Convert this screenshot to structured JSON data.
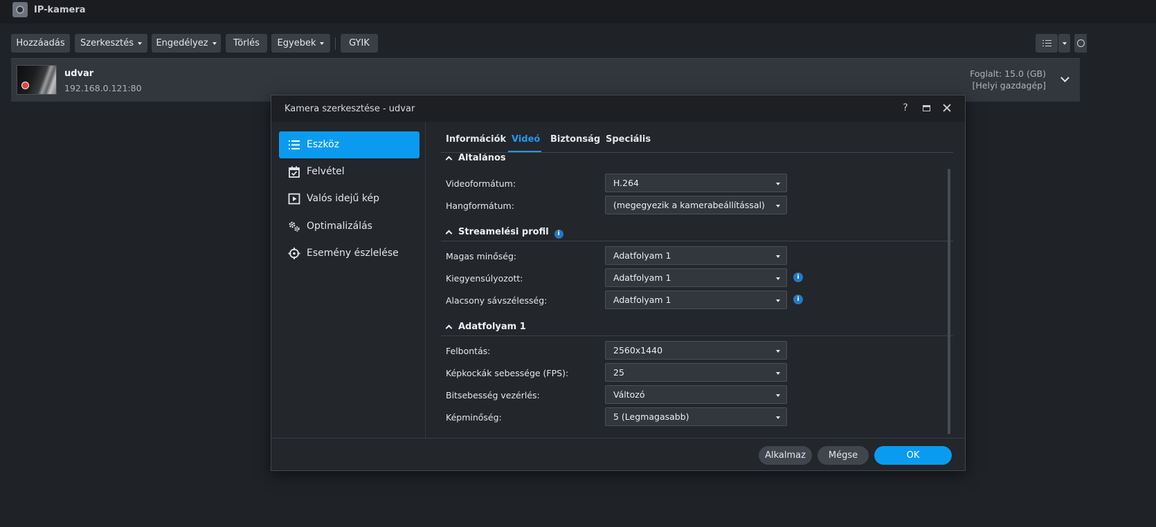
{
  "app": {
    "title": "IP-kamera"
  },
  "toolbar": {
    "add": "Hozzáadás",
    "edit": "Szerkesztés",
    "enable": "Engedélyez",
    "delete": "Törlés",
    "more": "Egyebek",
    "faq": "GYIK"
  },
  "camera": {
    "name": "udvar",
    "address": "192.168.0.121:80",
    "usage": "Foglalt: 15.0 (GB)",
    "host": "[Helyi gazdagép]"
  },
  "dialog": {
    "title": "Kamera szerkesztése - udvar",
    "help": "?",
    "sidebar": [
      {
        "label": "Eszköz",
        "icon": "list-icon",
        "active": true
      },
      {
        "label": "Felvétel",
        "icon": "calendar-icon"
      },
      {
        "label": "Valós idejű kép",
        "icon": "play-icon"
      },
      {
        "label": "Optimalizálás",
        "icon": "gears-icon"
      },
      {
        "label": "Esemény észlelése",
        "icon": "crosshair-icon"
      }
    ],
    "tabs": [
      "Információk",
      "Videó",
      "Biztonság",
      "Speciális"
    ],
    "active_tab": "Videó",
    "sections": {
      "general": {
        "title": "Általános",
        "video_format_label": "Videoformátum:",
        "video_format_value": "H.264",
        "audio_format_label": "Hangformátum:",
        "audio_format_value": "(megegyezik a kamerabeállítással)"
      },
      "streaming": {
        "title": "Streamelési profil",
        "high_label": "Magas minőség:",
        "high_value": "Adatfolyam 1",
        "balanced_label": "Kiegyensúlyozott:",
        "balanced_value": "Adatfolyam 1",
        "low_label": "Alacsony sávszélesség:",
        "low_value": "Adatfolyam 1"
      },
      "stream1": {
        "title": "Adatfolyam 1",
        "resolution_label": "Felbontás:",
        "resolution_value": "2560x1440",
        "fps_label": "Képkockák sebessége (FPS):",
        "fps_value": "25",
        "bitrate_label": "Bitsebesség vezérlés:",
        "bitrate_value": "Változó",
        "quality_label": "Képminőség:",
        "quality_value": "5 (Legmagasabb)"
      }
    },
    "footer": {
      "apply": "Alkalmaz",
      "cancel": "Mégse",
      "ok": "OK"
    }
  },
  "colors": {
    "accent": "#0a9bf0",
    "background": "#1f2227",
    "panel": "#23262b"
  }
}
